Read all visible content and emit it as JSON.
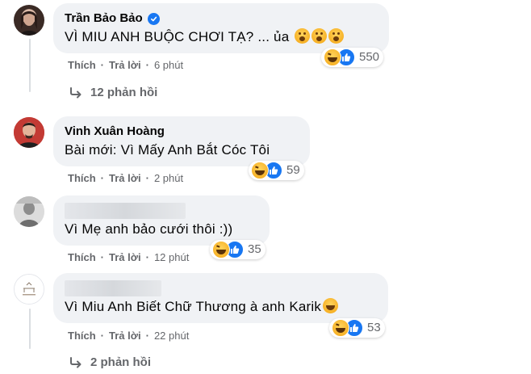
{
  "comments": [
    {
      "author": "Trần Bảo Bảo",
      "verified": true,
      "text": "VÌ MIU ANH BUỘC CHƠI TẠ? ... ủa",
      "inline_emoji": "astonished-face x3",
      "reaction_count": "550",
      "actions": {
        "like": "Thích",
        "reply": "Trả lời",
        "time": "6 phút"
      },
      "replies": "12 phản hồi"
    },
    {
      "author": "Vinh Xuân Hoàng",
      "text": "Bài mới: Vì Mấy Anh Bắt Cóc Tôi",
      "reaction_count": "59",
      "actions": {
        "like": "Thích",
        "reply": "Trả lời",
        "time": "2 phút"
      }
    },
    {
      "author": "",
      "author_blurred": true,
      "text": "Vì Mẹ anh bảo cưới thôi :))",
      "reaction_count": "35",
      "actions": {
        "like": "Thích",
        "reply": "Trả lời",
        "time": "12 phút"
      }
    },
    {
      "author": "",
      "author_blurred": true,
      "text": "Vì Miu Anh Biết Chữ Thương à anh Karik",
      "inline_emoji": "laughing-face",
      "reaction_count": "53",
      "actions": {
        "like": "Thích",
        "reply": "Trả lời",
        "time": "22 phút"
      },
      "replies": "2 phản hồi"
    }
  ],
  "separator": "·",
  "colors": {
    "bubble": "#f0f2f5",
    "meta": "#65676b",
    "like": "#1877f2",
    "haha": "#f7b125"
  }
}
